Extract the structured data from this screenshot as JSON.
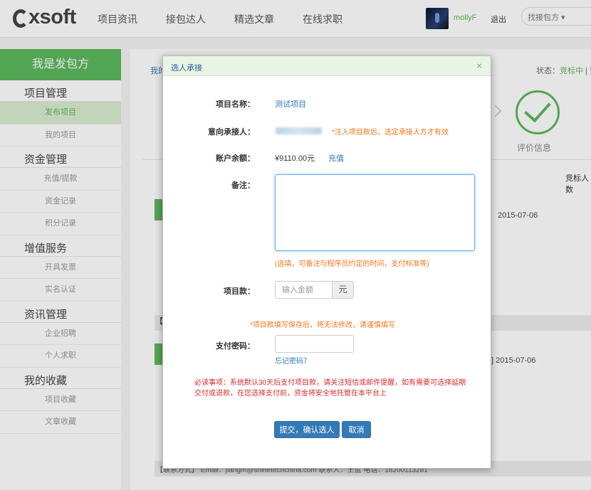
{
  "header": {
    "logo": "xsoft",
    "nav": [
      "项目资讯",
      "接包达人",
      "精选文章",
      "在线求职"
    ],
    "username": "mollyF",
    "logout": "退出",
    "search_placeholder": "找接包方 ▾"
  },
  "sidebar": {
    "title": "我是发包方",
    "groups": [
      {
        "title": "项目管理",
        "items": [
          "发布项目",
          "我的项目"
        ]
      },
      {
        "title": "资金管理",
        "items": [
          "充值/提款",
          "资金记录",
          "积分记录"
        ]
      },
      {
        "title": "增值服务",
        "items": [
          "开具发票",
          "实名认证"
        ]
      },
      {
        "title": "资讯管理",
        "items": [
          "企业招聘",
          "个人求职"
        ]
      },
      {
        "title": "我的收藏",
        "items": [
          "项目收藏",
          "文章收藏"
        ]
      }
    ]
  },
  "background": {
    "breadcrumb_fragment": "我的",
    "status_label": "状态：",
    "status_value": "竞标中",
    "status_tail": "| 预",
    "eval_label": "评价信息",
    "bidder_label": "竞标人数",
    "date1": "2015-07-06",
    "date2": "] 2015-07-06",
    "bar1_fragment": "【",
    "contact_line": "【联系方式】  Email：jiangm@shinetechchina.com     联系人：王蓝     电话：18200113281"
  },
  "modal": {
    "title": "选人承接",
    "close": "×",
    "project_name_label": "项目名称：",
    "project_name": "测试项目",
    "intended_label": "意向承接人：",
    "intended_note": "*注入项目款后，选定承接人方才有效",
    "balance_label": "账户余额：",
    "balance": "¥9110.00元",
    "recharge": "充值",
    "note_label": "备注：",
    "note_value": "",
    "note_hint": "(选填，可备注与程序员约定的时间，支付标准等)",
    "amount_label": "项目款：",
    "amount_placeholder": "输入金额",
    "amount_unit": "元",
    "amount_warning": "*项目款填写保存后，将无法修改，请谨慎填写",
    "password_label": "支付密码：",
    "forgot_password": "忘记密码？",
    "notice": "必读事项：系统默认30天后支付项目款，请关注短信或邮件提醒，如有需要可选择延期交付或退款，在您选择支付前，资金将安全地托管在本平台上",
    "submit": "提交，确认选人",
    "cancel": "取消"
  },
  "colors": {
    "brand_green": "#5cb85c",
    "primary_blue": "#337ab7",
    "warning_orange": "#f0771e",
    "danger_red": "#d82a2a"
  }
}
